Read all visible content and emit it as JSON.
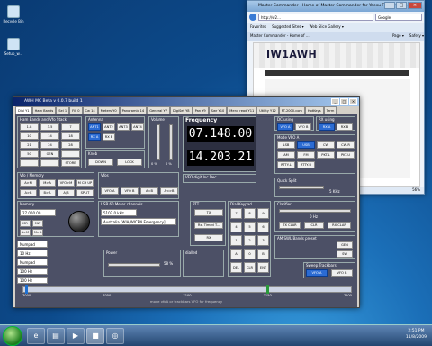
{
  "desktop": {
    "icons": [
      {
        "label": "Recycle Bin"
      },
      {
        "label": "Setup_w..."
      }
    ]
  },
  "browser": {
    "title": "Master Commander - Home of Master Commander for Yaesu FT-2000 - Wi...",
    "address": "http://w2...",
    "search_placeholder": "Google",
    "favorites_label": "Favorites",
    "fav_items": [
      "Suggested Sites ▾",
      "Web Slice Gallery ▾"
    ],
    "tab_label": "Master Commander - Home of ...",
    "toolbar_items": [
      "Page ▾",
      "Safety ▾"
    ],
    "site_title": "IW1AWH",
    "zoom": "56%"
  },
  "app": {
    "title": "AWH MC Beta v 0.0.7 build 1",
    "tabs": [
      "Dial Y1",
      "Ham Bands",
      "Sel 1",
      "Fil. 0",
      "Cw 14",
      "Meters Y0",
      "Panoramic 14",
      "General Y7",
      "DigiSet Y8",
      "Pan Y9",
      "Swr Y10",
      "Menu read Y11",
      "Utility Y12",
      "FT-2000.com",
      "HotKeys",
      "Term"
    ],
    "frequency_label": "Frequency",
    "freq_a": "07.148.00",
    "freq_b": "14.203.21",
    "panels": {
      "ham_bands": "Ham Bands and Vfo Stack",
      "antenna": "Antenna",
      "volume": "Volume",
      "knob": "Knob",
      "vfo_memory": "Vfo / Memory",
      "vfos": "Vfos",
      "memory": "Memory",
      "usb60": "USB 60 Meter channels",
      "ptt": "PTT",
      "dial_keypad": "Dial Keypad",
      "power": "Power",
      "dialled": "dialled",
      "vfo_digit": "VFO digit Inc Dec",
      "dc_using": "DC using",
      "rx_using": "RX using",
      "mode_vfo_a": "Mode VFO A",
      "quick_split": "Quick Split",
      "clarifier": "Clarifier",
      "am_swl": "AM SWL Bands preset",
      "sweep": "Sweep Trackbars"
    },
    "band_buttons": [
      "1.8",
      "3.5",
      "7",
      "10",
      "14",
      "18",
      "21",
      "24",
      "28",
      "50",
      "GEN",
      "",
      "",
      "",
      "STORE"
    ],
    "antenna_buttons": [
      "ANT1",
      "ANT2",
      "ANT3",
      "ANT4"
    ],
    "rx_buttons": [
      "RX A",
      "RX B"
    ],
    "knob_buttons": [
      "DOWN",
      "LOCK"
    ],
    "vfo_mem_buttons": [
      "A>M",
      "M>A",
      "VFO>M",
      "M CH UP",
      "A>B",
      "B>A",
      "A/B",
      "SPLIT"
    ],
    "vfos_buttons": [
      "VFO A",
      "VFO B",
      "A=B",
      "A<>B"
    ],
    "memory_value": "27.000.00",
    "memory_buttons": [
      "MR",
      "MW",
      "A>M",
      "M>A"
    ],
    "usb60_value": "5102.0 kHz",
    "usb60_caption": "Australia [WIA/WICEN Emergency]",
    "ptt_buttons": [
      "TX",
      "Rx. Timed T...",
      "RX"
    ],
    "keypad": [
      "7",
      "8",
      "9",
      "4",
      "5",
      "6",
      "1",
      "2",
      "3",
      "A",
      "0",
      "B",
      "DEL",
      "CLR",
      "ENT"
    ],
    "mode_buttons": [
      "LSB",
      "USB",
      "CW",
      "CW-R",
      "AM",
      "FM",
      "PKT-L",
      "PKT-U",
      "RTTY-L",
      "RTTY-U"
    ],
    "quick_split_value": "5 KHz",
    "clarifier_value": "0 Hz",
    "clarifier_buttons": [
      "TX CLAR",
      "CLR",
      "RX CLAR"
    ],
    "swl_buttons": [
      "GEN",
      "SW"
    ],
    "sweep_buttons": [
      "VFO A",
      "VFO B"
    ],
    "power_value": "58 %",
    "volume_labels": [
      "0 %",
      "0 %"
    ],
    "numpad_labels": [
      "Numpad",
      "Numpad"
    ],
    "step_values": [
      "10 Hz",
      "100 Hz",
      "100 Hz"
    ],
    "sweep_ticks": [
      "7000",
      "7050",
      "7100",
      "7150",
      "7200"
    ],
    "sweep_caption": "move vfoA or trackbars VFO for frequency"
  },
  "taskbar": {
    "time": "2:51 PM",
    "date": "11/8/2009"
  }
}
